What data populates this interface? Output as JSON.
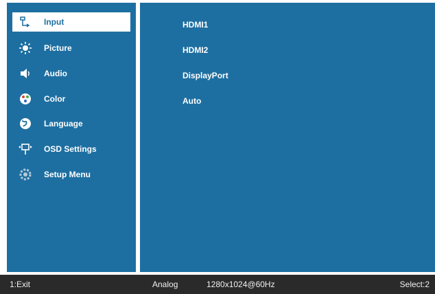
{
  "menu": {
    "items": [
      {
        "label": "Input",
        "icon": "input-icon",
        "selected": true
      },
      {
        "label": "Picture",
        "icon": "sun-icon"
      },
      {
        "label": "Audio",
        "icon": "speaker-icon"
      },
      {
        "label": "Color",
        "icon": "palette-icon"
      },
      {
        "label": "Language",
        "icon": "globe-icon"
      },
      {
        "label": "OSD Settings",
        "icon": "osd-icon"
      },
      {
        "label": "Setup Menu",
        "icon": "gear-icon"
      }
    ]
  },
  "input_options": [
    "HDMI1",
    "HDMI2",
    "DisplayPort",
    "Auto"
  ],
  "status": {
    "exit": "1:Exit",
    "signal": "Analog",
    "resolution": "1280x1024@60Hz",
    "select": "Select:2"
  },
  "colors": {
    "panel": "#1e6fa1",
    "status_bar": "#2a2a2a",
    "text": "#ffffff"
  }
}
